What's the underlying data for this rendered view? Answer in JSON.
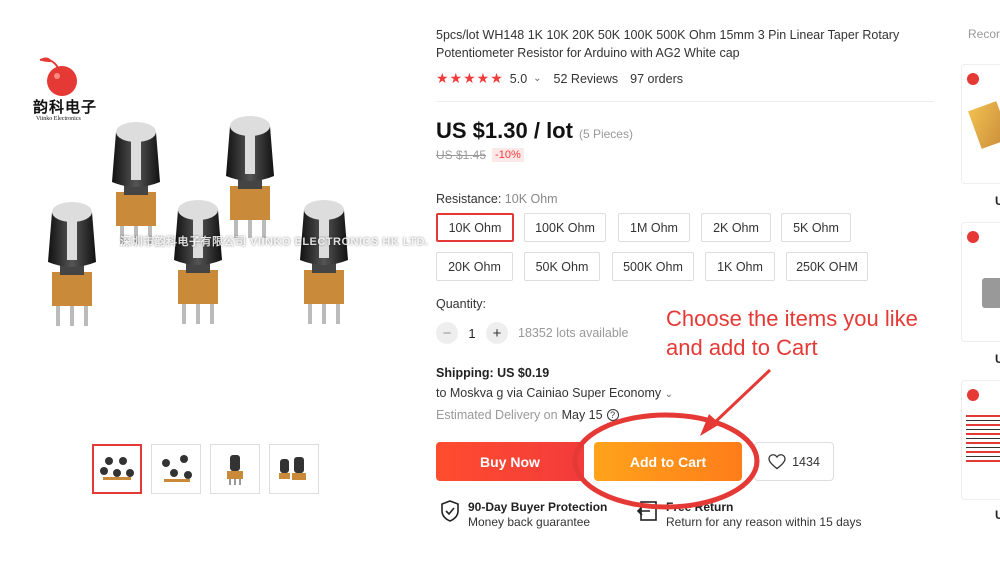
{
  "brand": {
    "name_cn": "韵科电子",
    "name_en": "Viinko Electronics"
  },
  "gallery": {
    "watermark": "深圳市韵科电子有限公司 VIINKO ELECTRONICS HK LTD.",
    "thumbnail_count": 4,
    "active_thumbnail": 1
  },
  "product": {
    "title": "5pcs/lot WH148 1K 10K 20K 50K 100K 500K Ohm 15mm 3 Pin Linear Taper Rotary Potentiometer Resistor for Arduino with AG2 White cap",
    "stars": "★★★★★",
    "rating": "5.0",
    "rating_caret": "⌄",
    "reviews": "52 Reviews",
    "orders": "97 orders"
  },
  "price": {
    "current": "US $1.30 / lot",
    "pieces": "(5 Pieces)",
    "original": "US $1.45",
    "discount": "-10%"
  },
  "resistance": {
    "label": "Resistance:",
    "selected": "10K Ohm",
    "options": [
      "10K Ohm",
      "100K Ohm",
      "1M Ohm",
      "2K Ohm",
      "5K Ohm",
      "20K Ohm",
      "50K Ohm",
      "500K Ohm",
      "1K Ohm",
      "250K OHM"
    ]
  },
  "quantity": {
    "label": "Quantity:",
    "minus": "−",
    "value": "1",
    "plus": "+",
    "available": "18352 lots available"
  },
  "shipping": {
    "label": "Shipping: US $0.19",
    "to": "to Moskva g via Cainiao Super Economy",
    "caret": "⌄",
    "estimated_label": "Estimated Delivery on",
    "estimated_date": "May 15",
    "help_icon": "?"
  },
  "actions": {
    "buy_now": "Buy Now",
    "add_to_cart": "Add to Cart",
    "wishlist_count": "1434"
  },
  "guarantees": {
    "buyer_protection_title": "90-Day Buyer Protection",
    "buyer_protection_sub": "Money back guarantee",
    "free_return_title": "Free Return",
    "free_return_sub": "Return for any reason within 15 days"
  },
  "annotation": {
    "line1": "Choose the items you like",
    "line2": "and add to Cart",
    "color": "#e53935"
  },
  "recommend": {
    "label": "Recor",
    "card_prices": [
      "U",
      "U",
      "U"
    ]
  },
  "colors": {
    "accent_red": "#f23b3b",
    "cart_orange": "#ff8c1a"
  }
}
